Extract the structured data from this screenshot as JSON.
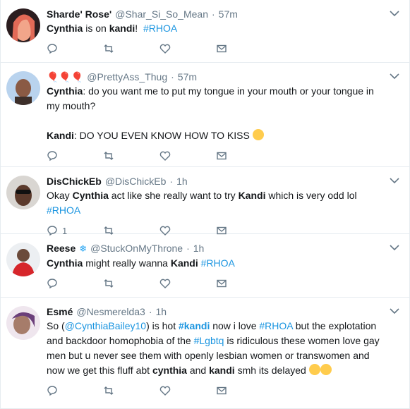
{
  "tweets": [
    {
      "name": "Sharde' Rose'",
      "handle": "@Shar_Si_So_Mean",
      "time": "57m",
      "text": [
        {
          "t": "Cynthia",
          "b": true
        },
        {
          "t": " is on "
        },
        {
          "t": "kandi",
          "b": true
        },
        {
          "t": "!  "
        },
        {
          "t": "#RHOA",
          "tag": true
        }
      ],
      "reply_count": "",
      "avatar_color": "#f2a58a"
    },
    {
      "name": "",
      "handle": "@PrettyAss_Thug",
      "time": "57m",
      "pins": "🎈🎈🎈",
      "text_line1": [
        {
          "t": "Cynthia",
          "b": true
        },
        {
          "t": ": do you want me to put my tongue in your mouth or your tongue in my mouth?"
        }
      ],
      "text_line2": [
        {
          "t": "Kandi",
          "b": true
        },
        {
          "t": ": DO YOU EVEN KNOW HOW TO KISS "
        }
      ],
      "reply_count": "",
      "avatar_color": "#a8c7e8"
    },
    {
      "name": "DisChickEb",
      "handle": "@DisChickEb",
      "time": "1h",
      "text": [
        {
          "t": "Okay "
        },
        {
          "t": "Cynthia",
          "b": true
        },
        {
          "t": " act like she really want to try "
        },
        {
          "t": "Kandi",
          "b": true
        },
        {
          "t": " which is very odd lol "
        },
        {
          "t": "#RHOA",
          "tag": true
        }
      ],
      "reply_count": "1",
      "avatar_color": "#c9c6c3"
    },
    {
      "name": "Reese",
      "handle": "@StuckOnMyThrone",
      "time": "1h",
      "text": [
        {
          "t": "Cynthia",
          "b": true
        },
        {
          "t": " might really wanna "
        },
        {
          "t": "Kandi",
          "b": true
        },
        {
          "t": " "
        },
        {
          "t": "#RHOA",
          "tag": true
        }
      ],
      "reply_count": "",
      "avatar_color": "#e0e4e8"
    },
    {
      "name": "Esmé",
      "handle": "@Nesmerelda3",
      "time": "1h",
      "text": [
        {
          "t": "So ("
        },
        {
          "t": "@CynthiaBailey10",
          "tag": true
        },
        {
          "t": ") is hot "
        },
        {
          "t": "#kandi",
          "tag": true,
          "b": true
        },
        {
          "t": " now i love "
        },
        {
          "t": "#RHOA",
          "tag": true
        },
        {
          "t": " but the explotation and backdoor homophobia of the "
        },
        {
          "t": "#Lgbtq",
          "tag": true
        },
        {
          "t": " is ridiculous these women love gay men but u never see them with openly lesbian women or transwomen and now we get this fluff abt "
        },
        {
          "t": "cynthia",
          "b": true
        },
        {
          "t": " and "
        },
        {
          "t": "kandi",
          "b": true
        },
        {
          "t": " smh its delayed "
        }
      ],
      "reply_count": "",
      "avatar_color": "#d8c2d6"
    }
  ],
  "separators": {
    "dot": "·"
  }
}
